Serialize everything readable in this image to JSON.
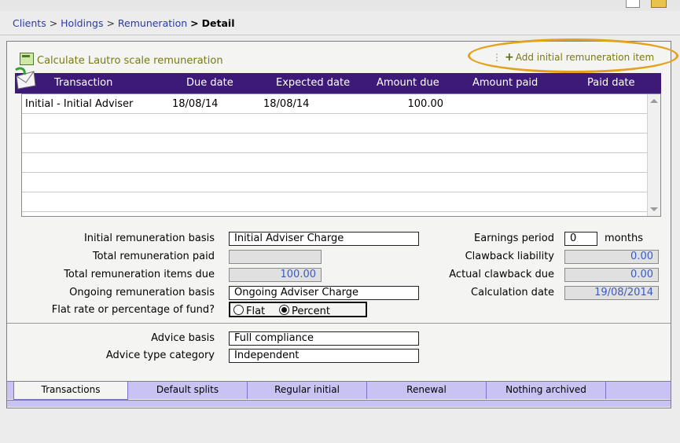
{
  "breadcrumb": {
    "items": [
      "Clients",
      "Holdings",
      "Remuneration"
    ],
    "separator": ">",
    "current": "Detail"
  },
  "actions": {
    "calculate_label": "Calculate Lautro scale remuneration",
    "add_label": "Add initial remuneration item"
  },
  "table": {
    "columns": [
      "Transaction",
      "Due date",
      "Expected date",
      "Amount due",
      "Amount paid",
      "Paid date"
    ],
    "rows": [
      {
        "transaction": "Initial - Initial Adviser",
        "due_date": "18/08/14",
        "expected_date": "18/08/14",
        "amount_due": "100.00",
        "amount_paid": "",
        "paid_date": ""
      }
    ]
  },
  "form": {
    "initial_basis_label": "Initial remuneration basis",
    "initial_basis_value": "Initial Adviser Charge",
    "total_paid_label": "Total remuneration paid",
    "total_paid_value": "",
    "items_due_label": "Total remuneration items due",
    "items_due_value": "100.00",
    "ongoing_basis_label": "Ongoing remuneration basis",
    "ongoing_basis_value": "Ongoing Adviser Charge",
    "flat_or_pct_label": "Flat rate or percentage of fund?",
    "flat_option": "Flat",
    "percent_option": "Percent",
    "selected_option": "Percent",
    "earnings_period_label": "Earnings period",
    "earnings_period_value": "0",
    "earnings_period_unit": "months",
    "clawback_liability_label": "Clawback liability",
    "clawback_liability_value": "0.00",
    "actual_clawback_label": "Actual clawback due",
    "actual_clawback_value": "0.00",
    "calc_date_label": "Calculation date",
    "calc_date_value": "19/08/2014",
    "advice_basis_label": "Advice basis",
    "advice_basis_value": "Full compliance",
    "advice_type_label": "Advice type category",
    "advice_type_value": "Independent"
  },
  "tabs": [
    "Transactions",
    "Default splits",
    "Regular initial",
    "Renewal",
    "Nothing archived"
  ],
  "colors": {
    "header_bg": "#3d1a78",
    "tab_bg": "#c9c3f3",
    "link": "#2a3aa8",
    "highlight_oval": "#e2a21c",
    "readonly_value": "#3a5ac0"
  }
}
